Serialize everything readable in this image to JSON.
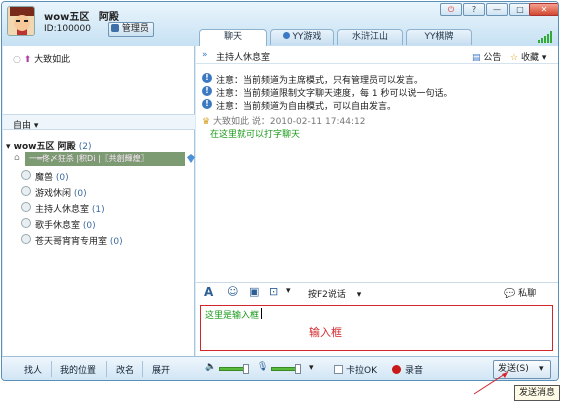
{
  "window": {
    "user_server": "wow五区",
    "user_name": "阿殿",
    "user_id": "ID:100000",
    "admin_badge": "管理员",
    "window_buttons": [
      "?",
      "—",
      "□"
    ]
  },
  "tabs": [
    {
      "label": "聊天",
      "active": true
    },
    {
      "label": "YY游戏",
      "active": false
    },
    {
      "label": "水浒江山",
      "active": false
    },
    {
      "label": "YY棋牌",
      "active": false
    }
  ],
  "left": {
    "top_user": "大致如此",
    "mode_label": "自由",
    "channel_root": {
      "name": "wow五区 阿殿",
      "count": "(2)"
    },
    "selected_user": "一═佟〆狂杀 |积Di |〖共創輝煌〗",
    "sub_channels": [
      {
        "name": "魔兽",
        "count": "(0)"
      },
      {
        "name": "游戏休闲",
        "count": "(0)"
      },
      {
        "name": "主持人休息室",
        "count": "(1)"
      },
      {
        "name": "歌手休息室",
        "count": "(0)"
      },
      {
        "name": "苍天哥宵宵专用室",
        "count": "(0)"
      }
    ]
  },
  "right": {
    "header_title": "主持人休息室",
    "announcement": "公告",
    "favorite": "收藏",
    "notices": [
      "注意：当前频道为主席模式，只有管理员可以发言。",
      "注意：当前频道限制文字聊天速度，每 1 秒可以说一句话。",
      "注意：当前频道为自由模式，可以自由发言。"
    ],
    "chat_sender": "大致如此",
    "chat_said": "说：2010-02-11 17:44:12",
    "chat_message": "在这里就可以打字聊天",
    "toolbar_talk": "按F2说话",
    "private_chat": "私聊",
    "input_text": "这里是输入框",
    "input_annotation": "输入框"
  },
  "bottom": {
    "left_buttons": [
      "找人",
      "我的位置",
      "改名",
      "展开"
    ],
    "karaoke": "卡拉OK",
    "record": "录音",
    "send": "发送(S)",
    "tooltip": "发送消息"
  },
  "colors": {
    "accent": "#3b79c2",
    "annotation_red": "#d3262c",
    "chat_green": "#1a9a1a"
  }
}
